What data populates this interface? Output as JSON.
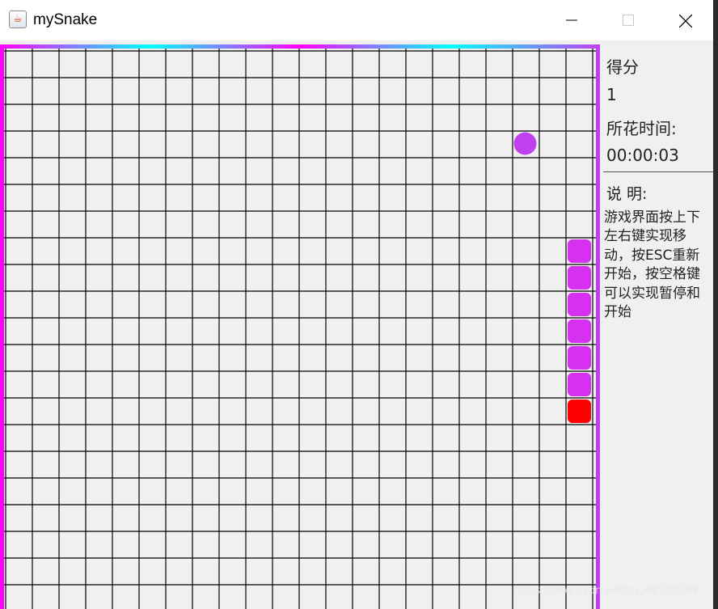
{
  "window": {
    "title": "mySnake",
    "icon": "java-cup-icon",
    "controls": [
      "minimize-icon",
      "maximize-icon",
      "close-icon"
    ]
  },
  "board": {
    "cols": 22,
    "rows": 21,
    "grid_color": "#000000",
    "background": "#f0f0f0",
    "border_colors": [
      "#ff00ff",
      "#00ffff",
      "#ff00ff",
      "#00ffff",
      "#c040f0"
    ],
    "food": {
      "col": 19,
      "row": 3,
      "color": "#c040f0"
    },
    "snake": {
      "body_color": "#d630f0",
      "head_color": "#ff0000",
      "cells": [
        {
          "col": 21,
          "row": 7
        },
        {
          "col": 21,
          "row": 8
        },
        {
          "col": 21,
          "row": 9
        },
        {
          "col": 21,
          "row": 10
        },
        {
          "col": 21,
          "row": 11
        },
        {
          "col": 21,
          "row": 12
        },
        {
          "col": 21,
          "row": 13
        }
      ],
      "head_index": 6
    }
  },
  "sidebar": {
    "score_label": "得分",
    "score_value": "1",
    "time_label": "所花时间:",
    "time_value": "00:00:03",
    "help_label": "说 明:",
    "help_text": "游戏界面按上下左右键实现移动，按ESC重新开始，按空格键可以实现暂停和开始"
  },
  "watermark": "https://blog.csdn.net/qq_44726549"
}
